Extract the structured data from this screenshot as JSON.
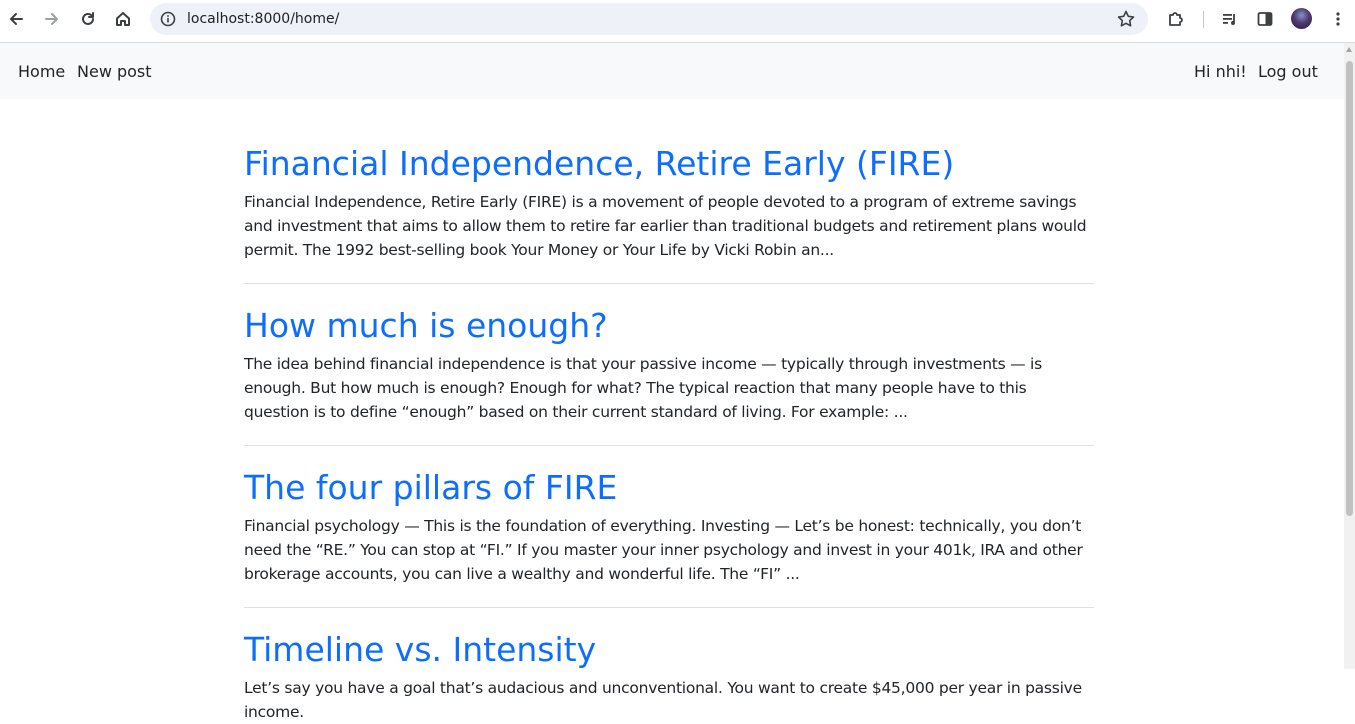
{
  "browser": {
    "url": "localhost:8000/home/",
    "icons": [
      "back-arrow-icon",
      "forward-arrow-icon",
      "reload-icon",
      "home-icon",
      "site-info-icon",
      "bookmark-star-icon",
      "extensions-puzzle-icon",
      "media-queue-icon",
      "side-panel-icon",
      "profile-avatar",
      "kebab-menu-icon"
    ]
  },
  "navbar": {
    "left_links": [
      {
        "label": "Home"
      },
      {
        "label": "New post"
      }
    ],
    "greeting": "Hi nhi!",
    "logout_label": "Log out"
  },
  "posts": [
    {
      "title": "Financial Independence, Retire Early (FIRE)",
      "excerpt": "Financial Independence, Retire Early (FIRE) is a movement of people devoted to a program of extreme savings and investment that aims to allow them to retire far earlier than traditional budgets and retirement plans would permit. The 1992 best-selling book Your Money or Your Life by Vicki Robin an..."
    },
    {
      "title": "How much is enough?",
      "excerpt": "The idea behind financial independence is that your passive income — typically through investments — is enough. But how much is enough? Enough for what? The typical reaction that many people have to this question is to define “enough” based on their current standard of living. For example: ..."
    },
    {
      "title": "The four pillars of FIRE",
      "excerpt": "Financial psychology — This is the foundation of everything. Investing — Let’s be honest: technically, you don’t need the “RE.” You can stop at “FI.” If you master your inner psychology and invest in your 401k, IRA and other brokerage accounts, you can live a wealthy and wonderful life. The “FI” ..."
    },
    {
      "title": "Timeline vs. Intensity",
      "excerpt": "Let’s say you have a goal that’s audacious and unconventional. You want to create $45,000 per year in passive income."
    }
  ],
  "colors": {
    "link": "#0d6efd",
    "navbar_bg": "#f8f9fa",
    "text": "#212529",
    "divider": "#dee2e6"
  }
}
